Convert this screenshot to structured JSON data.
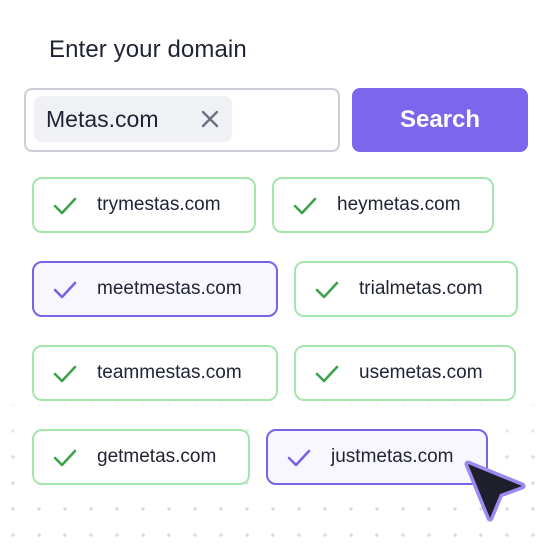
{
  "prompt": "Enter your domain",
  "search": {
    "chip_value": "Metas.com",
    "clear_icon": "close-icon",
    "button_label": "Search"
  },
  "colors": {
    "accent": "#7c66eb",
    "available_border": "#a6e6ac",
    "available_check": "#3fa34d",
    "selected_border": "#7b62e4"
  },
  "suggestions": [
    {
      "domain": "trymestas.com",
      "selected": false
    },
    {
      "domain": "heymetas.com",
      "selected": false
    },
    {
      "domain": "meetmestas.com",
      "selected": true
    },
    {
      "domain": "trialmetas.com",
      "selected": false
    },
    {
      "domain": "teammestas.com",
      "selected": false
    },
    {
      "domain": "usemetas.com",
      "selected": false
    },
    {
      "domain": "getmetas.com",
      "selected": false
    },
    {
      "domain": "justmetas.com",
      "selected": true
    }
  ],
  "cursor_icon": "pointer-arrow-icon"
}
